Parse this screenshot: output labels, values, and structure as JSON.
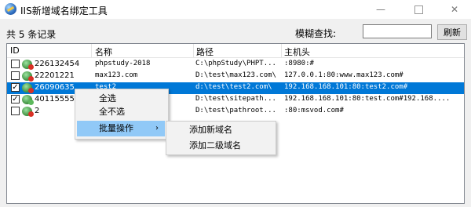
{
  "window": {
    "title": "IIS新增域名绑定工具"
  },
  "toolbar": {
    "record_count": "共 5 条记录",
    "search_label": "模糊查找:",
    "search_value": "",
    "refresh_label": "刷新"
  },
  "table": {
    "columns": [
      "ID",
      "名称",
      "路径",
      "主机头"
    ],
    "rows": [
      {
        "checked": false,
        "id": "226132454",
        "name": "phpstudy-2018",
        "path": "C:\\phpStudy\\PHPT...",
        "host": ":8980:#",
        "status": "error"
      },
      {
        "checked": false,
        "id": "22201221",
        "name": "max123.com",
        "path": "D:\\test\\max123.com\\",
        "host": "127.0.0.1:80:www.max123.com#",
        "status": "error"
      },
      {
        "checked": true,
        "id": "26090635",
        "name": "test2",
        "path": "d:\\test\\test2.com\\",
        "host": "192.168.168.101:80:test2.com#",
        "status": "error",
        "selected": true
      },
      {
        "checked": true,
        "id": "401155554",
        "name": "",
        "path": "D:\\test\\sitepath...",
        "host": "192.168.168.101:80:test.com#192.168....",
        "status": "ok"
      },
      {
        "checked": false,
        "id": "2",
        "name": "",
        "path": "D:\\test\\pathroot...",
        "host": ":80:msvod.com#",
        "status": "error"
      }
    ]
  },
  "context_menu": {
    "items": [
      "全选",
      "全不选",
      "批量操作"
    ],
    "submenu": [
      "添加新域名",
      "添加二级域名"
    ]
  }
}
